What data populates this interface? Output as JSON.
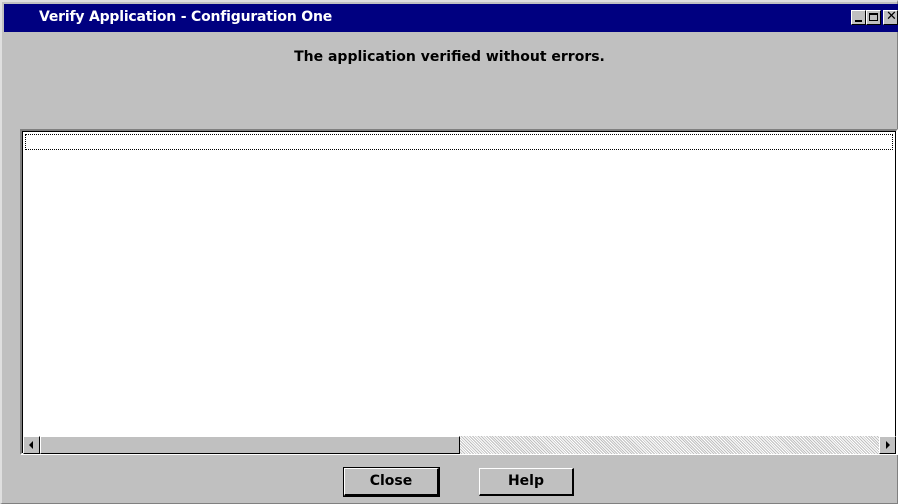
{
  "window": {
    "title": "Verify Application - Configuration One",
    "controls": {
      "minimize_icon": "minimize-icon",
      "maximize_icon": "maximize-icon",
      "close_glyph": "✕"
    }
  },
  "main": {
    "message": "The application verified without errors.",
    "results_list": {
      "items": []
    }
  },
  "buttons": {
    "close_label": "Close",
    "help_label": "Help"
  },
  "colors": {
    "title_bar": "#000080",
    "face": "#c0c0c0",
    "list_background": "#ffffff"
  }
}
